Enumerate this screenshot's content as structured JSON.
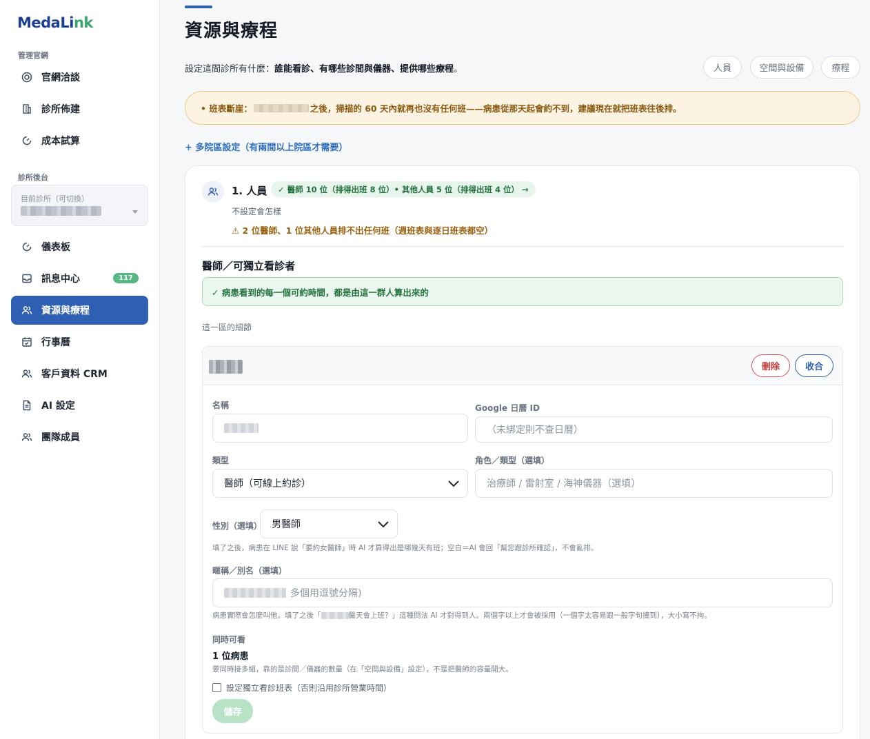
{
  "brand": {
    "name_a": "MedaLi",
    "name_b": "nk"
  },
  "sidebar": {
    "section_site": "管理官網",
    "site_items": [
      {
        "label": "官網洽談",
        "icon": "target-icon"
      },
      {
        "label": "診所佈建",
        "icon": "building-icon"
      },
      {
        "label": "成本試算",
        "icon": "gauge-icon"
      }
    ],
    "section_backend": "診所後台",
    "clinic_select_caption": "目前診所（可切換）",
    "backend_items": [
      {
        "label": "儀表板",
        "icon": "gauge-icon"
      },
      {
        "label": "訊息中心",
        "icon": "inbox-icon",
        "badge": "117"
      },
      {
        "label": "資源與療程",
        "icon": "users-icon",
        "active": true
      },
      {
        "label": "行事曆",
        "icon": "calendar-icon"
      },
      {
        "label": "客戶資料 CRM",
        "icon": "users-icon"
      },
      {
        "label": "AI 設定",
        "icon": "document-icon"
      },
      {
        "label": "團隊成員",
        "icon": "users-icon"
      }
    ]
  },
  "page": {
    "title": "資源與療程",
    "subtitle_prefix": "設定這間診所有什麼：",
    "subtitle_bold": "誰能看診、有哪些診間與儀器、提供哪些療程",
    "subtitle_suffix": "。",
    "pills": [
      "人員",
      "空間與設備",
      "療程"
    ],
    "warning_prefix": "• 班表斷崖：",
    "warning_suffix": "之後，掃描的 60 天內就再也沒有任何班——病患從那天起會約不到，建議現在就把班表往後排。",
    "multi_site_link": "+ 多院區設定（有兩間以上院區才需要）"
  },
  "staff_section": {
    "title": "1. 人員",
    "status_chip": "✓ 醫師 10 位（排得出班 8 位）• 其他人員 5 位（排得出班 4 位） →",
    "desc": "不設定會怎樣",
    "warning": "⚠ 2 位醫師、1 位其他人員排不出任何班（週班表與逐日班表都空）",
    "doctors_heading": "醫師／可獨立看診者",
    "success_msg": "✓ 病患看到的每一個可約時間，都是由這一群人算出來的",
    "detail_label": "這一區的細節"
  },
  "form": {
    "delete_label": "刪除",
    "collapse_label": "收合",
    "name_label": "名稱",
    "gcal_label": "Google 日曆 ID",
    "gcal_placeholder": "（未綁定則不查日曆）",
    "type_label": "類型",
    "type_value": "醫師（可線上約診）",
    "role_label": "角色／類型（選填）",
    "role_placeholder": "治療師 / 雷射室 / 海神儀器（選填）",
    "gender_label": "性別（選填）",
    "gender_value": "男醫師",
    "gender_hint": "填了之後，病患在 LINE 說「要約女醫師」時 AI 才算得出是哪幾天有班；空白＝AI 會回「幫您跟診所確認」，不會亂排。",
    "nickname_label": "暱稱／別名（選填）",
    "nickname_suffix": "多個用逗號分隔)",
    "nickname_hint_a": "病患實際會怎麼叫他。填了之後「",
    "nickname_hint_b": "醫天會上班？」這種問法 AI 才對得到人。兩個字以上才會被採用（一個字太容易跟一般字句撞到），大小寫不拘。",
    "concurrent_label": "同時可看",
    "concurrent_value": "1 位病患",
    "concurrent_hint": "要同時接多組，靠的是診間／儀器的數量（在「空間與設備」設定），不是把醫師的容量開大。",
    "schedule_checkbox": "設定獨立看診班表（否則沿用診所營業時間）",
    "save_label": "儲存"
  }
}
